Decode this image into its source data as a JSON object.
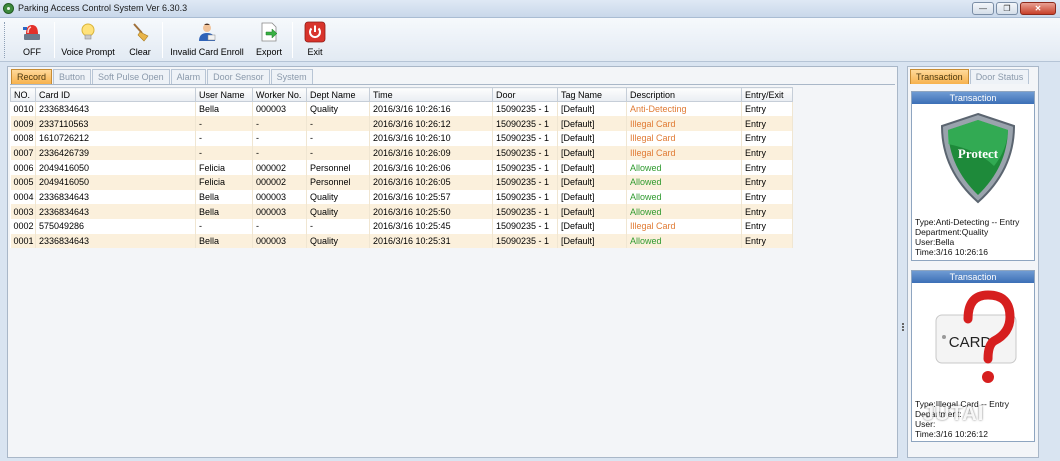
{
  "window": {
    "title": "Parking Access Control System  Ver 6.30.3"
  },
  "toolbar": {
    "off": "OFF",
    "voice_prompt": "Voice Prompt",
    "clear": "Clear",
    "invalid_card_enroll": "Invalid Card Enroll",
    "export": "Export",
    "exit": "Exit"
  },
  "tabs": [
    "Record",
    "Button",
    "Soft Pulse Open",
    "Alarm",
    "Door Sensor",
    "System"
  ],
  "table": {
    "headers": [
      "NO.",
      "Card ID",
      "User Name",
      "Worker No.",
      "Dept Name",
      "Time",
      "Door",
      "Tag Name",
      "Description",
      "Entry/Exit"
    ],
    "rows": [
      [
        "0010",
        "2336834643",
        "Bella",
        "000003",
        "Quality",
        "2016/3/16 10:26:16",
        "15090235 - 1",
        "[Default]",
        "Anti-Detecting",
        "Entry"
      ],
      [
        "0009",
        "2337110563",
        "-",
        "-",
        "-",
        "2016/3/16 10:26:12",
        "15090235 - 1",
        "[Default]",
        "Illegal Card",
        "Entry"
      ],
      [
        "0008",
        "1610726212",
        "-",
        "-",
        "-",
        "2016/3/16 10:26:10",
        "15090235 - 1",
        "[Default]",
        "Illegal Card",
        "Entry"
      ],
      [
        "0007",
        "2336426739",
        "-",
        "-",
        "-",
        "2016/3/16 10:26:09",
        "15090235 - 1",
        "[Default]",
        "Illegal Card",
        "Entry"
      ],
      [
        "0006",
        "2049416050",
        "Felicia",
        "000002",
        "Personnel",
        "2016/3/16 10:26:06",
        "15090235 - 1",
        "[Default]",
        "Allowed",
        "Entry"
      ],
      [
        "0005",
        "2049416050",
        "Felicia",
        "000002",
        "Personnel",
        "2016/3/16 10:26:05",
        "15090235 - 1",
        "[Default]",
        "Allowed",
        "Entry"
      ],
      [
        "0004",
        "2336834643",
        "Bella",
        "000003",
        "Quality",
        "2016/3/16 10:25:57",
        "15090235 - 1",
        "[Default]",
        "Allowed",
        "Entry"
      ],
      [
        "0003",
        "2336834643",
        "Bella",
        "000003",
        "Quality",
        "2016/3/16 10:25:50",
        "15090235 - 1",
        "[Default]",
        "Allowed",
        "Entry"
      ],
      [
        "0002",
        "575049286",
        "-",
        "-",
        "-",
        "2016/3/16 10:25:45",
        "15090235 - 1",
        "[Default]",
        "Illegal Card",
        "Entry"
      ],
      [
        "0001",
        "2336834643",
        "Bella",
        "000003",
        "Quality",
        "2016/3/16 10:25:31",
        "15090235 - 1",
        "[Default]",
        "Allowed",
        "Entry"
      ]
    ]
  },
  "right_tabs": [
    "Transaction",
    "Door Status"
  ],
  "transactions": [
    {
      "header": "Transaction",
      "image_text": "Protect",
      "lines": [
        "Type:Anti-Detecting -- Entry",
        "Department:Quality",
        "User:Bella",
        "Time:3/16 10:26:16"
      ]
    },
    {
      "header": "Transaction",
      "image_text": "CARD",
      "lines": [
        "Type:Illegal Card -- Entry",
        "Department:",
        "User:",
        "Time:3/16 10:26:12"
      ]
    }
  ],
  "watermark": "JUTAI",
  "colors": {
    "allowed": "#2f9a2f",
    "warning": "#e07b35",
    "active_tab": "#f7b24e",
    "row_alt": "#fbf0dc"
  }
}
